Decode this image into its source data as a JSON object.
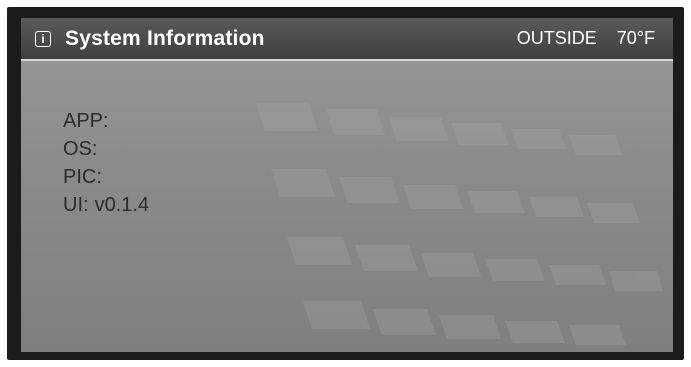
{
  "header": {
    "title": "System Information",
    "outside_label": "OUTSIDE",
    "outside_temp": "70°F",
    "icon": "info-icon"
  },
  "system_info": [
    {
      "label": "APP:",
      "value": ""
    },
    {
      "label": "OS:",
      "value": ""
    },
    {
      "label": "PIC:",
      "value": ""
    },
    {
      "label": "UI:",
      "value": "v0.1.4"
    }
  ]
}
